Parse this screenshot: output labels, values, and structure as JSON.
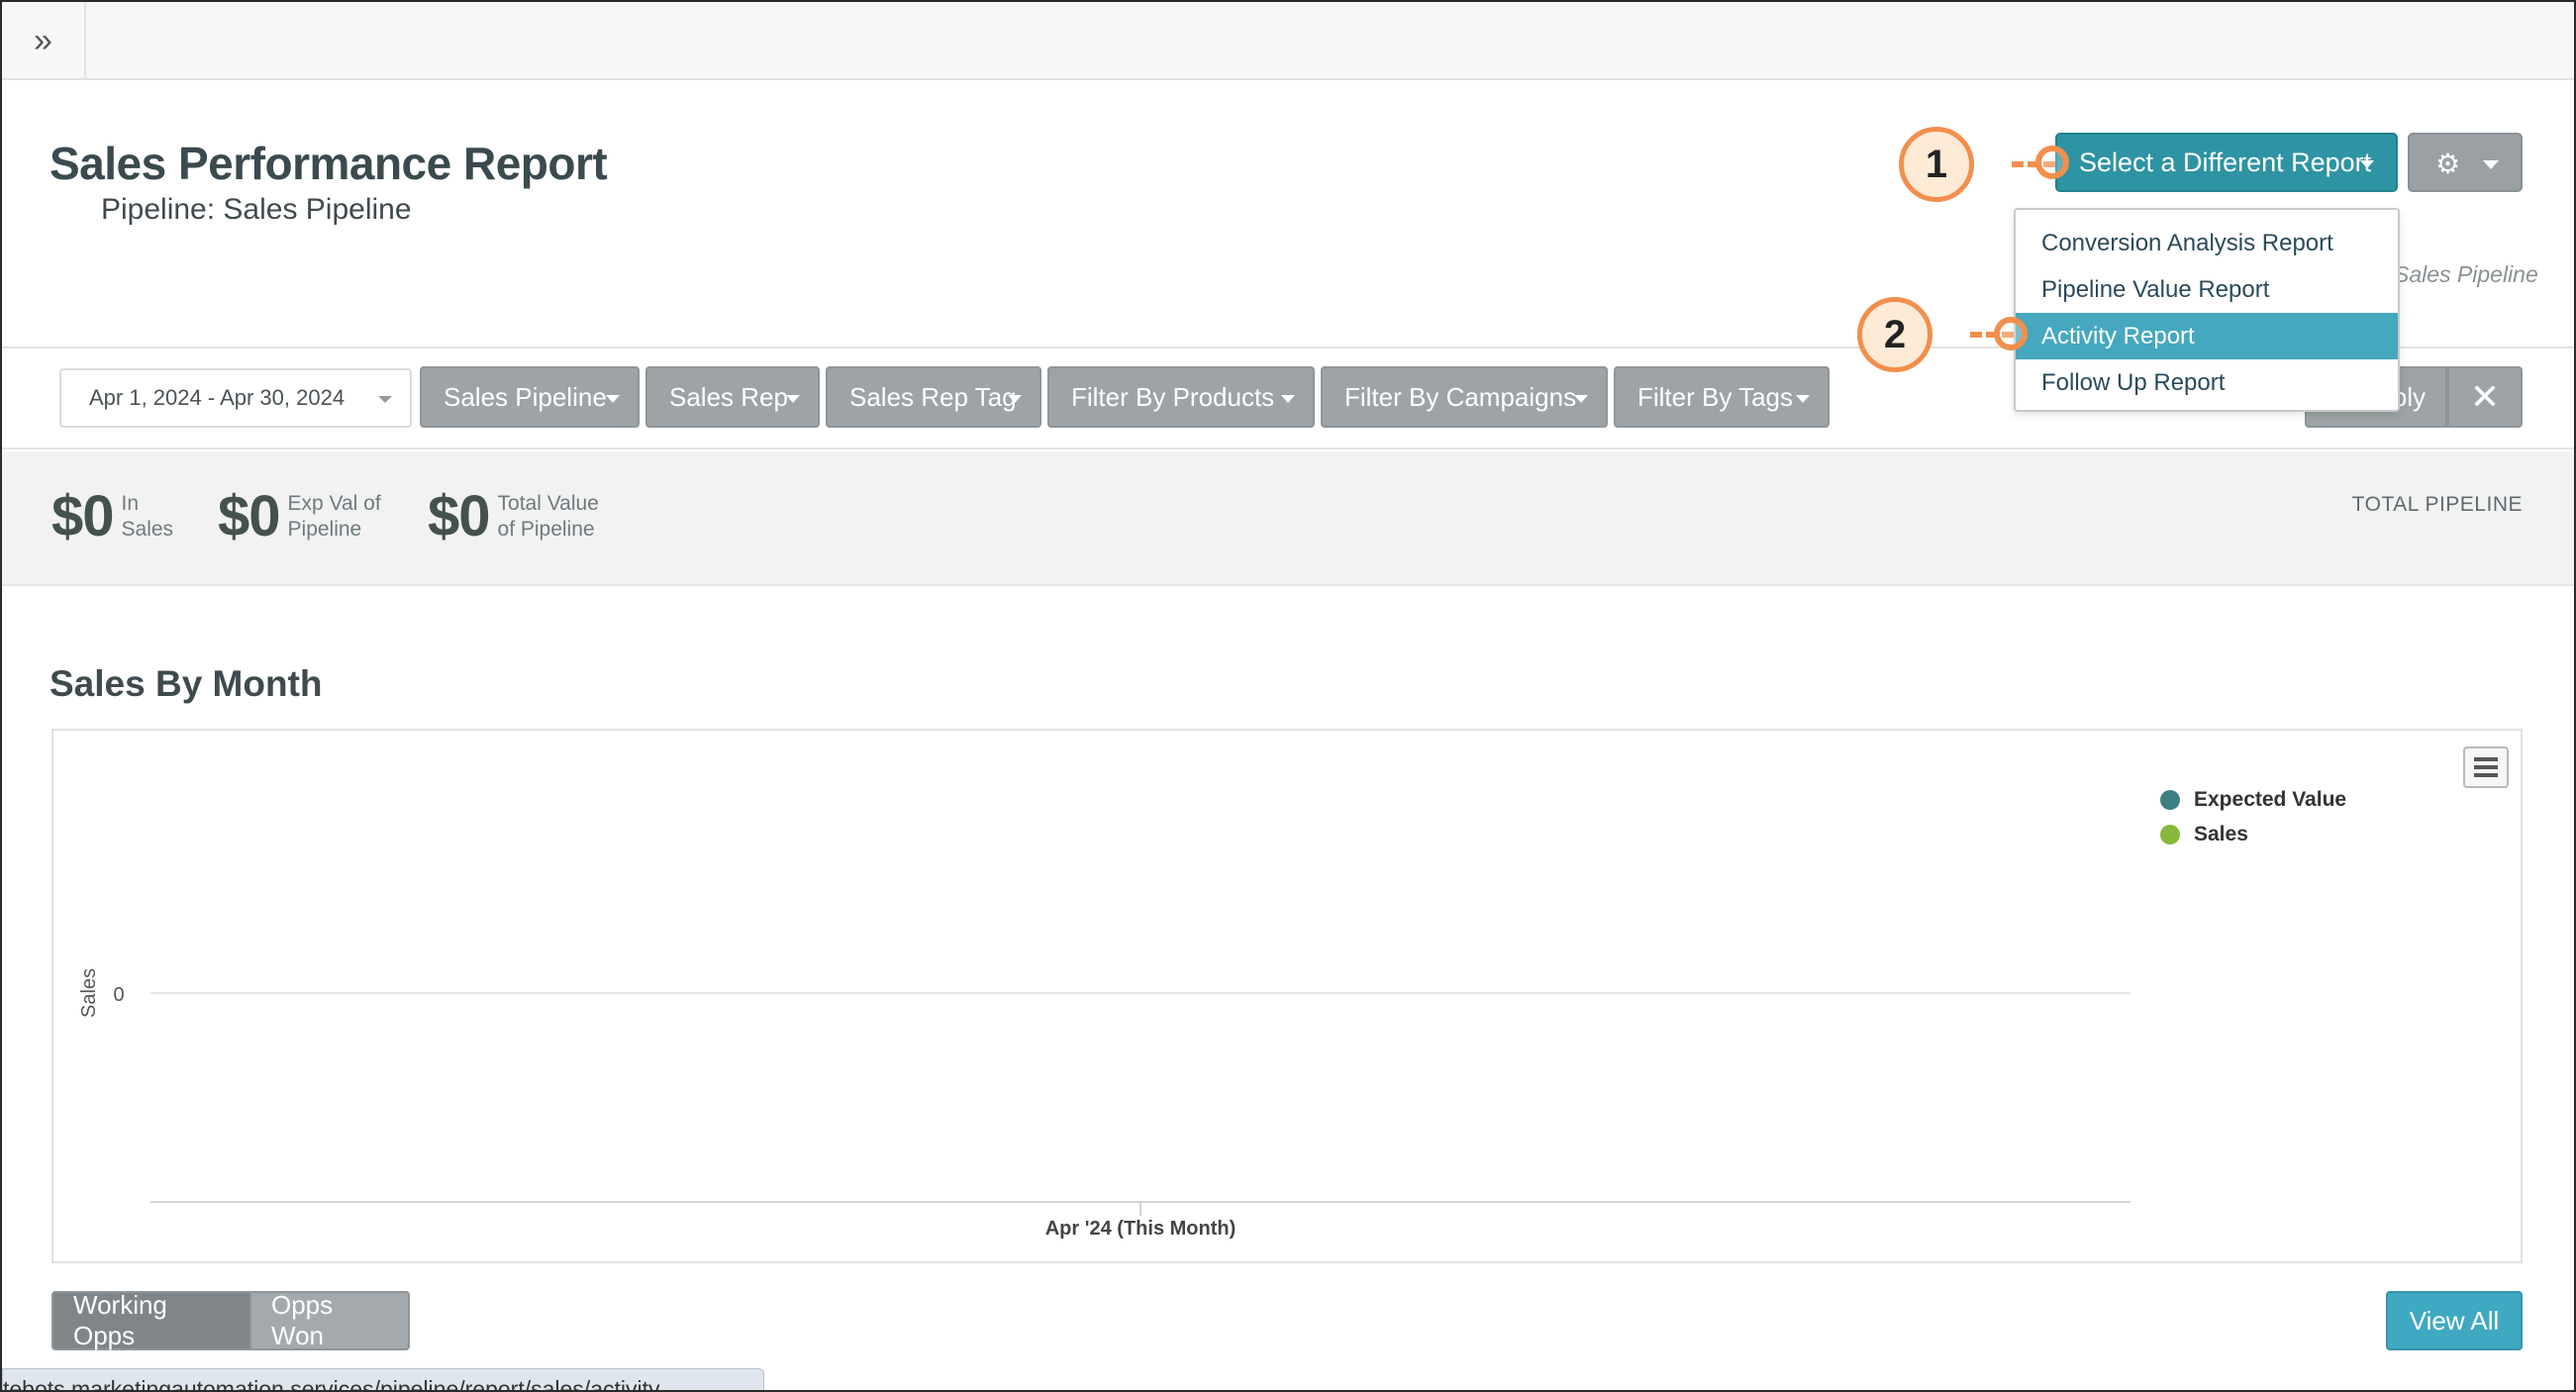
{
  "header": {
    "title": "Sales Performance Report",
    "subtitle": "Pipeline: Sales Pipeline",
    "select_report_label": "Select a Different Report",
    "pipeline_peek": "Sales Pipeline"
  },
  "dropdown": {
    "items": [
      {
        "label": "Conversion Analysis Report"
      },
      {
        "label": "Pipeline Value Report"
      },
      {
        "label": "Activity Report"
      },
      {
        "label": "Follow Up Report"
      }
    ],
    "active_index": 2
  },
  "filters": {
    "date_range": "Apr 1, 2024 - Apr 30, 2024",
    "buttons": [
      "Sales Pipeline",
      "Sales Rep",
      "Sales Rep Tag",
      "Filter By Products",
      "Filter By Campaigns",
      "Filter By Tags"
    ],
    "apply_label": "ply",
    "clear_label": "✕"
  },
  "stats": [
    {
      "amount": "$0",
      "label": "In Sales"
    },
    {
      "amount": "$0",
      "label": "Exp Val of Pipeline"
    },
    {
      "amount": "$0",
      "label": "Total Value of Pipeline"
    }
  ],
  "total_pipeline_label": "TOTAL PIPELINE",
  "chart_data": {
    "type": "line",
    "title": "Sales By Month",
    "categories": [
      "Apr '24 (This Month)"
    ],
    "ylabel": "Sales",
    "yticks": [
      "0"
    ],
    "series": [
      {
        "name": "Expected Value",
        "values": [
          0
        ],
        "color": "#3d7f85"
      },
      {
        "name": "Sales",
        "values": [
          0
        ],
        "color": "#86b83a"
      }
    ],
    "legend": "top-right"
  },
  "bottom": {
    "toggle": [
      "Working Opps",
      "Opps Won"
    ],
    "view_all_label": "View All"
  },
  "status_url": "tebots.marketingautomation.services/pipeline/report/sales/activity",
  "annotations": {
    "one": "1",
    "two": "2"
  },
  "colors": {
    "teal": "#2e93a3",
    "active_item": "#45a8be",
    "callout": "#f28f4d"
  }
}
